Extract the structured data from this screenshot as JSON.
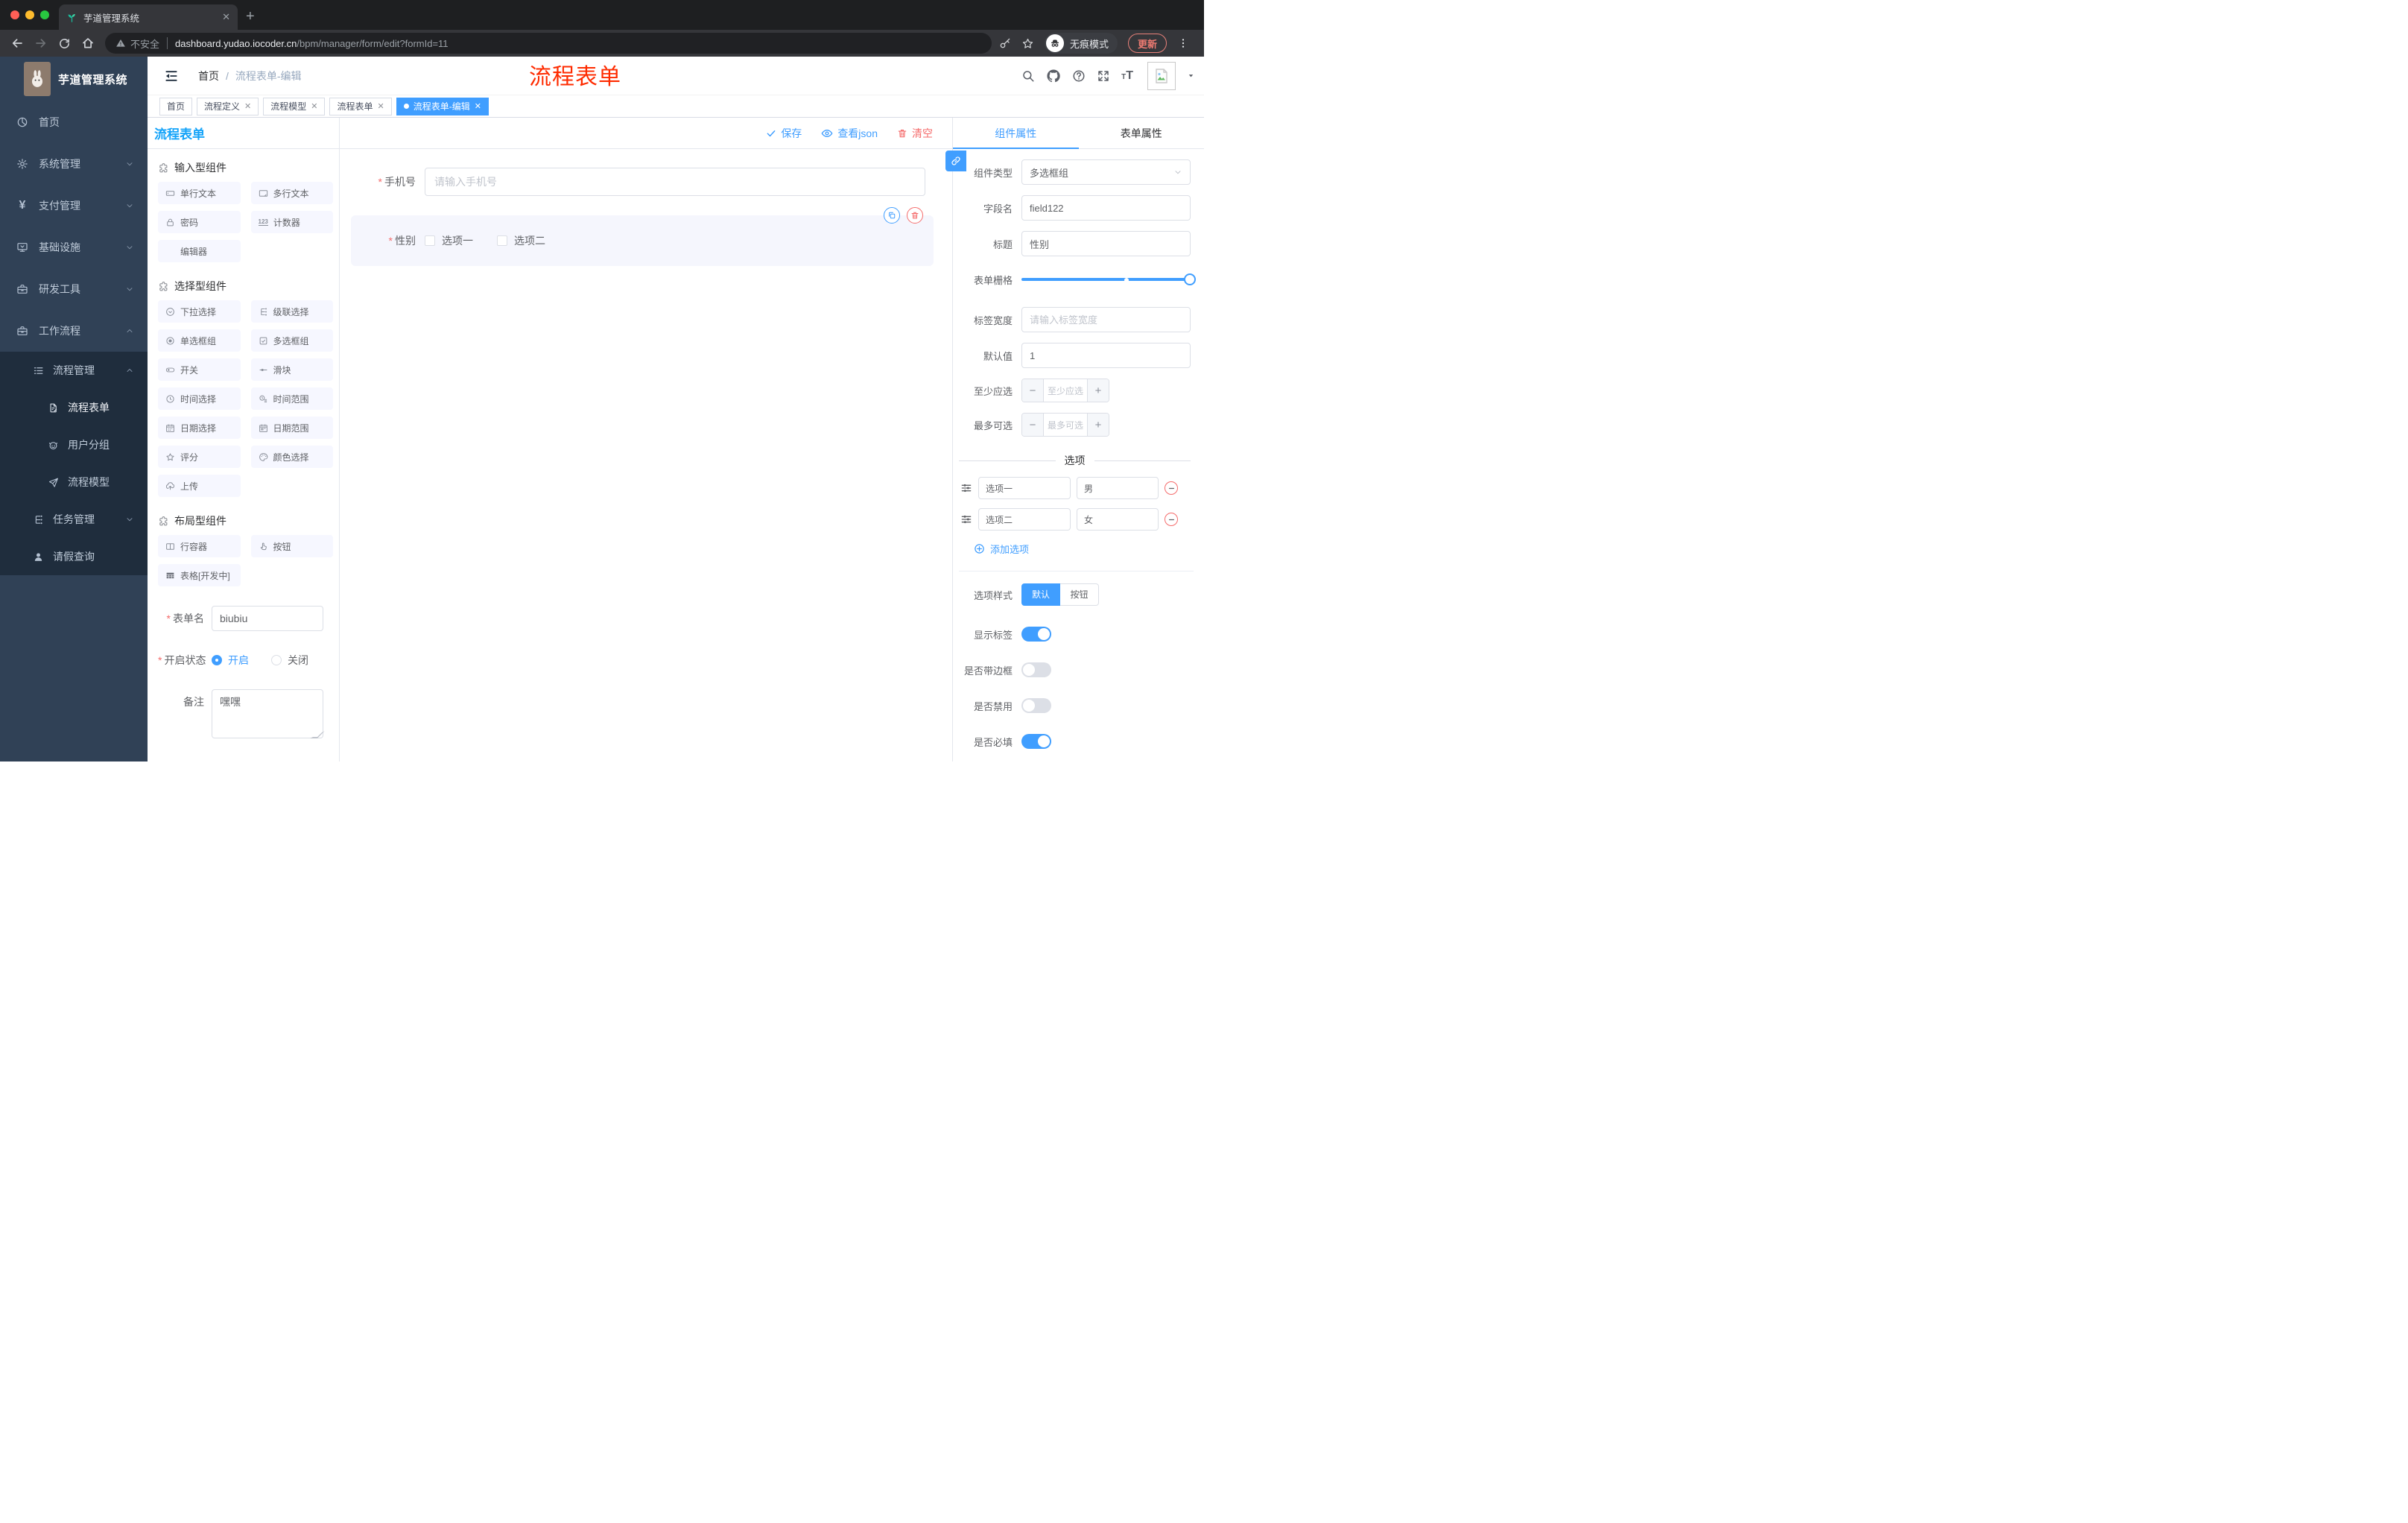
{
  "browser": {
    "tab_title": "芋道管理系统",
    "security": "不安全",
    "domain": "dashboard.yudao.iocoder.cn",
    "path": "/bpm/manager/form/edit?formId=11",
    "incognito": "无痕模式",
    "update": "更新"
  },
  "sidebar": {
    "logo": "芋道管理系统",
    "home": "首页",
    "system": "系统管理",
    "pay": "支付管理",
    "infra": "基础设施",
    "dev": "研发工具",
    "workflow": "工作流程",
    "process_mgmt": "流程管理",
    "process_form": "流程表单",
    "user_group": "用户分组",
    "process_model": "流程模型",
    "task_mgmt": "任务管理",
    "leave_query": "请假查询"
  },
  "header": {
    "breadcrumb_home": "首页",
    "breadcrumb_current": "流程表单-编辑",
    "annotation": "流程表单"
  },
  "tags": {
    "home": "首页",
    "t1": "流程定义",
    "t2": "流程模型",
    "t3": "流程表单",
    "active": "流程表单-编辑"
  },
  "left_panel": {
    "title": "流程表单",
    "s1": "输入型组件",
    "i_single": "单行文本",
    "i_multi": "多行文本",
    "i_password": "密码",
    "i_counter": "计数器",
    "i_editor": "编辑器",
    "s2": "选择型组件",
    "c_select": "下拉选择",
    "c_cascade": "级联选择",
    "c_radio": "单选框组",
    "c_check": "多选框组",
    "c_switch": "开关",
    "c_slider": "滑块",
    "c_time": "时间选择",
    "c_timerange": "时间范围",
    "c_date": "日期选择",
    "c_daterange": "日期范围",
    "c_rate": "评分",
    "c_color": "颜色选择",
    "c_upload": "上传",
    "s3": "布局型组件",
    "l_row": "行容器",
    "l_button": "按钮",
    "l_table": "表格[开发中]",
    "form_name_label": "表单名",
    "form_name_value": "biubiu",
    "status_label": "开启状态",
    "status_on": "开启",
    "status_off": "关闭",
    "remark_label": "备注",
    "remark_value": "嘿嘿"
  },
  "canvas": {
    "save": "保存",
    "view_json": "查看json",
    "clear": "清空",
    "phone_label": "手机号",
    "phone_placeholder": "请输入手机号",
    "gender_label": "性别",
    "gender_opt1": "选项一",
    "gender_opt2": "选项二"
  },
  "inspector": {
    "tab_component": "组件属性",
    "tab_form": "表单属性",
    "type_label": "组件类型",
    "type_value": "多选框组",
    "field_label": "字段名",
    "field_value": "field122",
    "title_label": "标题",
    "title_value": "性别",
    "grid_label": "表单栅格",
    "width_label": "标签宽度",
    "width_placeholder": "请输入标签宽度",
    "default_label": "默认值",
    "default_value": "1",
    "min_label": "至少应选",
    "min_placeholder": "至少应选",
    "max_label": "最多可选",
    "max_placeholder": "最多可选",
    "options_title": "选项",
    "opt1_label": "选项一",
    "opt1_value": "男",
    "opt2_label": "选项二",
    "opt2_value": "女",
    "add_option": "添加选项",
    "style_label": "选项样式",
    "style_default": "默认",
    "style_button": "按钮",
    "show_label": "显示标签",
    "border_label": "是否带边框",
    "disabled_label": "是否禁用",
    "required_label": "是否必填"
  },
  "colors": {
    "accent": "#409eff",
    "panel_title_blue": "#14a3f9",
    "danger": "#f56c6c",
    "annotation_red": "#fe2b00",
    "sidebar_bg": "#304156",
    "sidebar_sub_bg": "#1f2d3d"
  }
}
